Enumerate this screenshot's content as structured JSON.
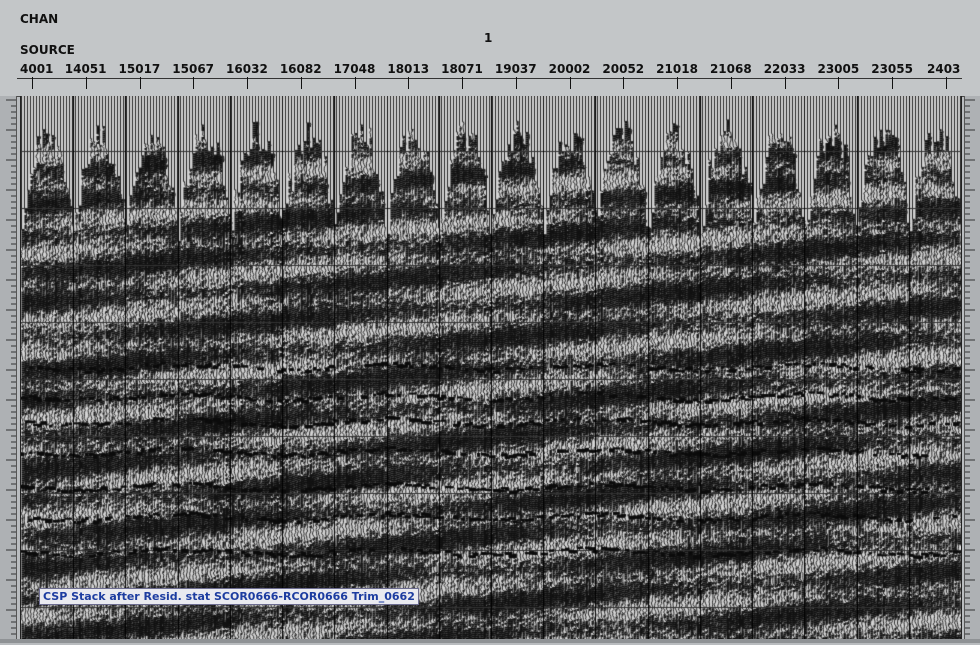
{
  "header": {
    "chan_label": "CHAN",
    "chan_value": "1",
    "source_label": "SOURCE",
    "source_ticks": [
      "4001",
      "14051",
      "15017",
      "15067",
      "16032",
      "16082",
      "17048",
      "18013",
      "18071",
      "19037",
      "20002",
      "20052",
      "21018",
      "21068",
      "22033",
      "23005",
      "23055",
      "2403"
    ]
  },
  "caption": "CSP Stack after Resid. stat SCOR0666-RCOR0666 Trim_0662",
  "colors": {
    "background": "#b9bcbf",
    "wiggle": "#111111",
    "caption_text": "#1c3ca0"
  }
}
